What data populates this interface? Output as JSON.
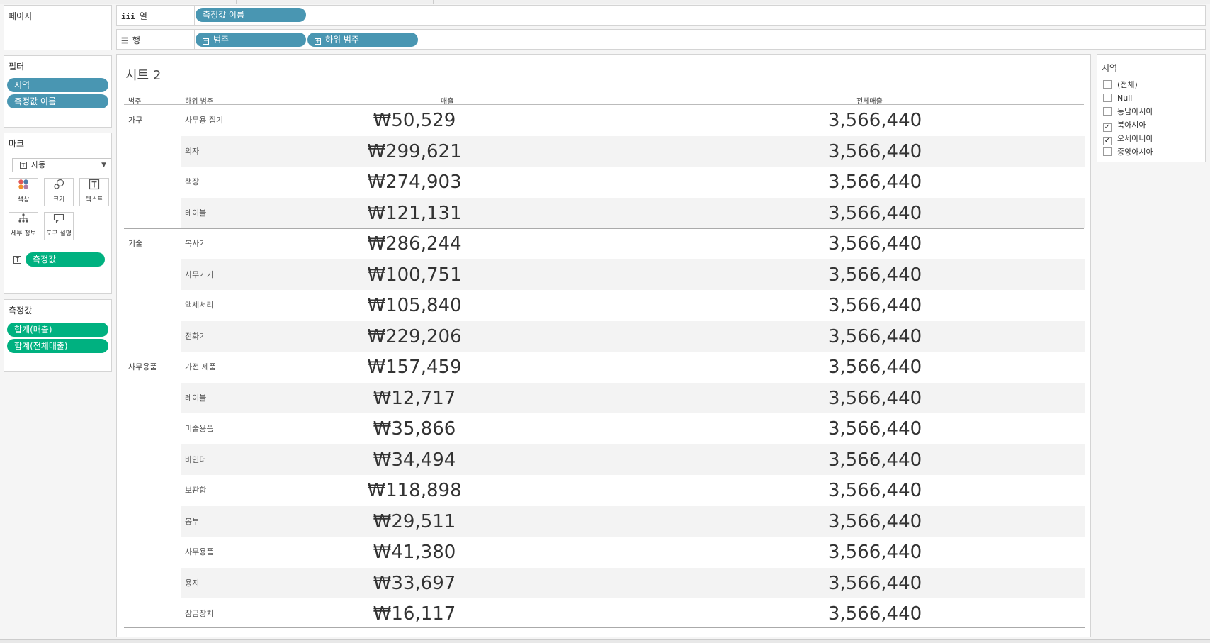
{
  "panels": {
    "pages": {
      "title": "페이지"
    },
    "filters": {
      "title": "필터",
      "pills": [
        "지역",
        "측정값 이름"
      ]
    },
    "marks": {
      "title": "마크",
      "type_dropdown": "자동",
      "buttons": {
        "color": "색상",
        "size": "크기",
        "text": "텍스트",
        "detail": "세부 정보",
        "tooltip": "도구 설명"
      },
      "text_pill": "측정값"
    },
    "measure_values": {
      "title": "측정값",
      "pills": [
        "합계(매출)",
        "합계(전체매출)"
      ]
    }
  },
  "shelves": {
    "columns": {
      "label": "열",
      "pills": [
        "측정값 이름"
      ]
    },
    "rows": {
      "label": "행",
      "pills": [
        "범주",
        "하위 범주"
      ]
    }
  },
  "sheet": {
    "title": "시트 2",
    "headers": {
      "category": "범주",
      "subcategory": "하위 범주",
      "sales": "매출",
      "total_sales": "전체매출"
    },
    "groups": [
      {
        "category": "가구",
        "rows": [
          {
            "sub": "사무용 집기",
            "sales": "₩50,529",
            "total": "3,566,440"
          },
          {
            "sub": "의자",
            "sales": "₩299,621",
            "total": "3,566,440"
          },
          {
            "sub": "책장",
            "sales": "₩274,903",
            "total": "3,566,440"
          },
          {
            "sub": "테이블",
            "sales": "₩121,131",
            "total": "3,566,440"
          }
        ]
      },
      {
        "category": "기술",
        "rows": [
          {
            "sub": "복사기",
            "sales": "₩286,244",
            "total": "3,566,440"
          },
          {
            "sub": "사무기기",
            "sales": "₩100,751",
            "total": "3,566,440"
          },
          {
            "sub": "액세서리",
            "sales": "₩105,840",
            "total": "3,566,440"
          },
          {
            "sub": "전화기",
            "sales": "₩229,206",
            "total": "3,566,440"
          }
        ]
      },
      {
        "category": "사무용품",
        "rows": [
          {
            "sub": "가전 제품",
            "sales": "₩157,459",
            "total": "3,566,440"
          },
          {
            "sub": "레이블",
            "sales": "₩12,717",
            "total": "3,566,440"
          },
          {
            "sub": "미술용품",
            "sales": "₩35,866",
            "total": "3,566,440"
          },
          {
            "sub": "바인더",
            "sales": "₩34,494",
            "total": "3,566,440"
          },
          {
            "sub": "보관함",
            "sales": "₩118,898",
            "total": "3,566,440"
          },
          {
            "sub": "봉투",
            "sales": "₩29,511",
            "total": "3,566,440"
          },
          {
            "sub": "사무용품",
            "sales": "₩41,380",
            "total": "3,566,440"
          },
          {
            "sub": "용지",
            "sales": "₩33,697",
            "total": "3,566,440"
          },
          {
            "sub": "잠금장치",
            "sales": "₩16,117",
            "total": "3,566,440"
          }
        ]
      }
    ]
  },
  "region_filter": {
    "title": "지역",
    "items": [
      {
        "label": "(전체)",
        "checked": false
      },
      {
        "label": "Null",
        "checked": false
      },
      {
        "label": "동남아시아",
        "checked": false
      },
      {
        "label": "북아시아",
        "checked": true
      },
      {
        "label": "오세아니아",
        "checked": true
      },
      {
        "label": "중앙아시아",
        "checked": false
      }
    ]
  },
  "colors": {
    "dimension_pill": "#4996b2",
    "measure_pill": "#00b180",
    "band": "#f3f3f3"
  }
}
